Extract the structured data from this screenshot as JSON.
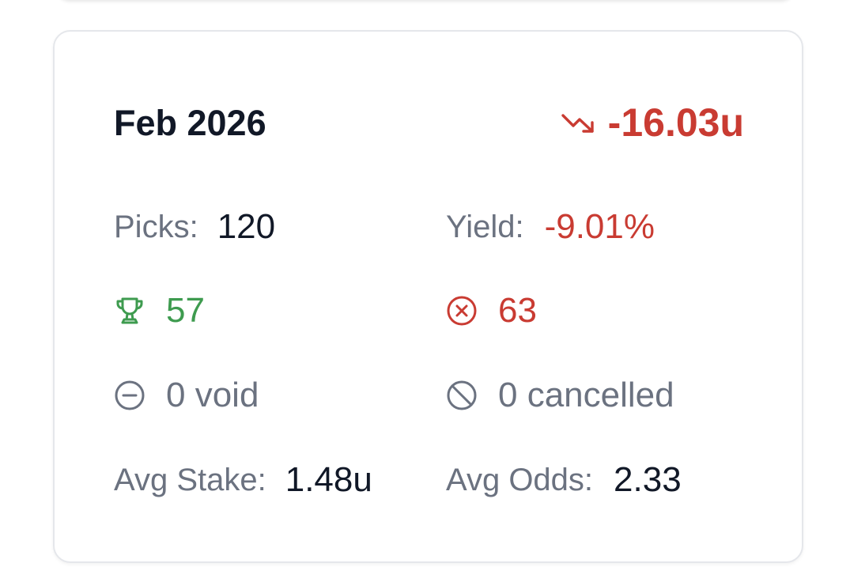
{
  "period": {
    "month_label": "Feb 2026",
    "total_units": "-16.03u",
    "total_trend": "down",
    "total_icon": "trending-down-icon"
  },
  "stats": {
    "picks_label": "Picks:",
    "picks_value": "120",
    "yield_label": "Yield:",
    "yield_value": "-9.01%",
    "wins_icon": "trophy-icon",
    "wins_value": "57",
    "losses_icon": "x-circle-icon",
    "losses_value": "63",
    "void_icon": "minus-circle-icon",
    "void_text": "0 void",
    "cancelled_icon": "ban-icon",
    "cancelled_text": "0 cancelled",
    "avg_stake_label": "Avg Stake:",
    "avg_stake_value": "1.48u",
    "avg_odds_label": "Avg Odds:",
    "avg_odds_value": "2.33"
  },
  "colors": {
    "negative": "#c93b32",
    "positive": "#3e9b4f",
    "muted": "#6b7280",
    "text": "#111827",
    "border": "#e5e7eb"
  }
}
